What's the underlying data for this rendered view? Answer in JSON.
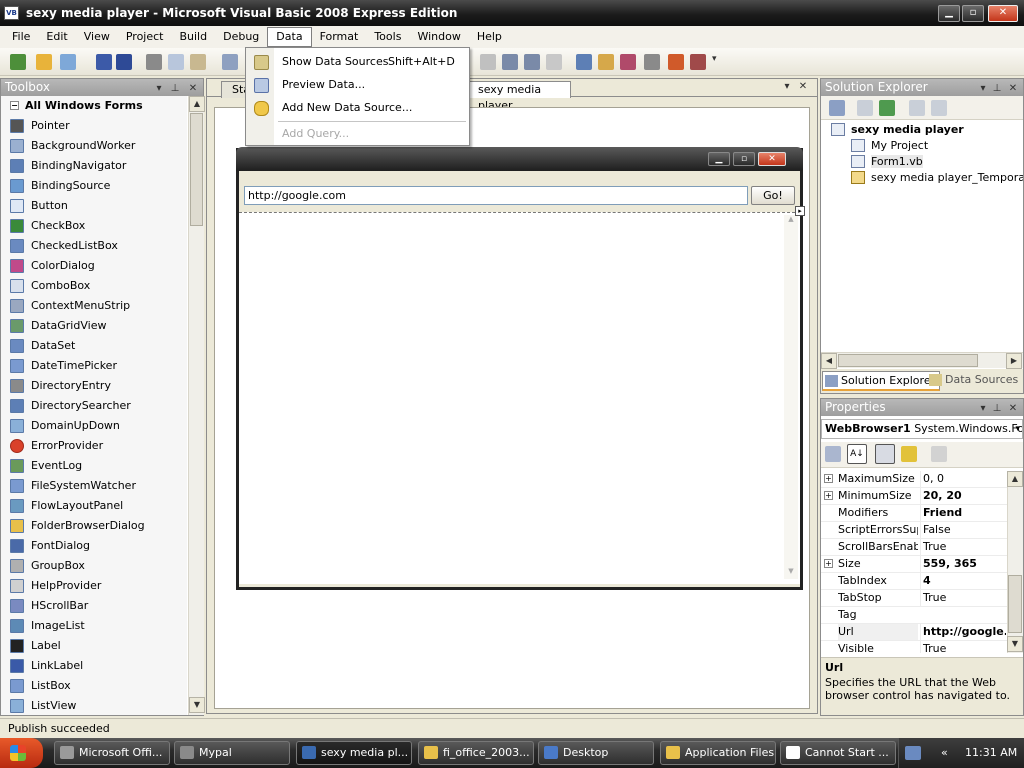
{
  "window": {
    "title": "sexy media player - Microsoft Visual Basic 2008 Express Edition",
    "app_icon": "VB"
  },
  "menubar": [
    "File",
    "Edit",
    "View",
    "Project",
    "Build",
    "Debug",
    "Data",
    "Format",
    "Tools",
    "Window",
    "Help"
  ],
  "data_menu": {
    "items": [
      {
        "label": "Show Data Sources",
        "shortcut": "Shift+Alt+D",
        "enabled": true
      },
      {
        "label": "Preview Data...",
        "shortcut": "",
        "enabled": true
      },
      {
        "label": "Add New Data Source...",
        "shortcut": "",
        "enabled": true
      },
      {
        "label": "Add Query...",
        "shortcut": "",
        "enabled": false
      }
    ]
  },
  "toolbox": {
    "title": "Toolbox",
    "category": "All Windows Forms",
    "items": [
      "Pointer",
      "BackgroundWorker",
      "BindingNavigator",
      "BindingSource",
      "Button",
      "CheckBox",
      "CheckedListBox",
      "ColorDialog",
      "ComboBox",
      "ContextMenuStrip",
      "DataGridView",
      "DataSet",
      "DateTimePicker",
      "DirectoryEntry",
      "DirectorySearcher",
      "DomainUpDown",
      "ErrorProvider",
      "EventLog",
      "FileSystemWatcher",
      "FlowLayoutPanel",
      "FolderBrowserDialog",
      "FontDialog",
      "GroupBox",
      "HelpProvider",
      "HScrollBar",
      "ImageList",
      "Label",
      "LinkLabel",
      "ListBox",
      "ListView"
    ]
  },
  "document": {
    "tabs": [
      "Sta",
      "sexy media player"
    ],
    "form": {
      "url_value": "http://google.com",
      "go_label": "Go!"
    }
  },
  "solution_explorer": {
    "title": "Solution Explorer",
    "project": "sexy media player",
    "items": [
      "My Project",
      "Form1.vb",
      "sexy media player_TemporaryK"
    ],
    "tabs": [
      "Solution Explorer",
      "Data Sources"
    ]
  },
  "properties": {
    "title": "Properties",
    "object_name": "WebBrowser1",
    "object_type": "System.Windows.For",
    "rows": [
      {
        "name": "MaximumSize",
        "value": "0, 0",
        "bold": false,
        "expand": true
      },
      {
        "name": "MinimumSize",
        "value": "20, 20",
        "bold": true,
        "expand": true
      },
      {
        "name": "Modifiers",
        "value": "Friend",
        "bold": true,
        "expand": false
      },
      {
        "name": "ScriptErrorsSupp",
        "value": "False",
        "bold": false,
        "expand": false
      },
      {
        "name": "ScrollBarsEnable",
        "value": "True",
        "bold": false,
        "expand": false
      },
      {
        "name": "Size",
        "value": "559, 365",
        "bold": true,
        "expand": true
      },
      {
        "name": "TabIndex",
        "value": "4",
        "bold": true,
        "expand": false
      },
      {
        "name": "TabStop",
        "value": "True",
        "bold": false,
        "expand": false
      },
      {
        "name": "Tag",
        "value": "",
        "bold": false,
        "expand": false
      },
      {
        "name": "Url",
        "value": "http://google.c",
        "bold": true,
        "expand": false
      },
      {
        "name": "Visible",
        "value": "True",
        "bold": false,
        "expand": false
      }
    ],
    "desc_title": "Url",
    "desc_text": "Specifies the URL that the Web browser control has navigated to."
  },
  "status": {
    "text": "Publish succeeded"
  },
  "taskbar": {
    "tasks": [
      "Microsoft Offi...",
      "Mypal",
      "sexy media pl...",
      "fi_office_2003...",
      "Desktop",
      "Application Files",
      "Cannot Start ..."
    ],
    "active_index": 2,
    "clock": "11:31 AM",
    "tray_chevron": "«"
  }
}
